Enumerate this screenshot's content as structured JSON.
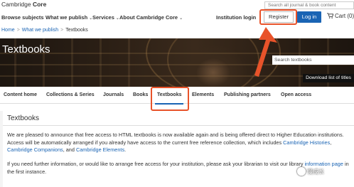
{
  "header": {
    "logo_brand": "Cambridge",
    "logo_product": "Core",
    "search_placeholder": "Search all journal & book content"
  },
  "nav": {
    "items": [
      {
        "label": "Browse subjects"
      },
      {
        "label": "What we publish"
      },
      {
        "label": "Services"
      },
      {
        "label": "About Cambridge Core"
      }
    ],
    "institution_login": "Institution login",
    "register": "Register",
    "login": "Log in",
    "cart": "Cart (0)"
  },
  "breadcrumb": {
    "home": "Home",
    "what_we_publish": "What we publish",
    "current": "Textbooks"
  },
  "hero": {
    "title": "Textbooks",
    "search_placeholder": "Search textbooks",
    "download_button": "Download list of titles"
  },
  "tabs": {
    "items": [
      {
        "label": "Content home"
      },
      {
        "label": "Collections & Series"
      },
      {
        "label": "Journals"
      },
      {
        "label": "Books"
      },
      {
        "label": "Textbooks"
      },
      {
        "label": "Elements"
      },
      {
        "label": "Publishing partners"
      },
      {
        "label": "Open access"
      }
    ],
    "active": "Textbooks"
  },
  "content": {
    "title": "Textbooks",
    "p1_a": "We are pleased to announce that free access to HTML textbooks is now available again and is being offered direct to Higher Education institutions. Access will be automatically arranged if you already have access to the current free reference collection, which includes ",
    "p1_link1": "Cambridge Histories",
    "p1_b": ", ",
    "p1_link2": "Cambridge Companions",
    "p1_c": ", and ",
    "p1_link3": "Cambridge Elements",
    "p1_d": ".",
    "p2_a": "If you need further information, or would like to arrange free access for your institution, please ask your librarian to visit our library ",
    "p2_link": "information page",
    "p2_b": " in the first instance."
  },
  "watermark": {
    "text": "慢成长"
  },
  "colors": {
    "accent_blue": "#1a64b4",
    "highlight_orange": "#e8532a"
  }
}
